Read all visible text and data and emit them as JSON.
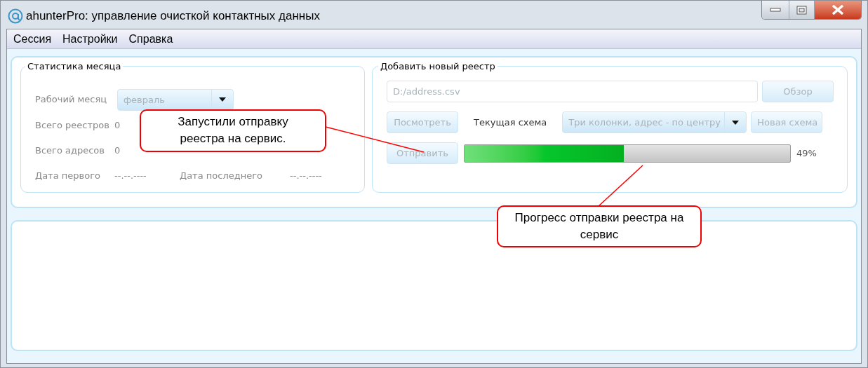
{
  "window": {
    "title": "ahunterPro: управление очисткой контактных данных"
  },
  "menu": [
    {
      "label": "Сессия"
    },
    {
      "label": "Настройки"
    },
    {
      "label": "Справка"
    }
  ],
  "month_stats": {
    "title": "Статистика месяца",
    "work_month": {
      "label": "Рабочий месяц",
      "value": "февраль",
      "disabled": true
    },
    "rows": [
      [
        {
          "label": "Всего реестров",
          "value": "0"
        }
      ],
      [
        {
          "label": "Всего адресов",
          "value": "0"
        }
      ],
      [
        {
          "label": "Дата первого",
          "value": "--.--.----"
        },
        {
          "label": "Дата последнего",
          "value": "--.--.----"
        }
      ]
    ]
  },
  "new_registry": {
    "title": "Добавить новый реестр",
    "file_field": {
      "value": "D:/address.csv",
      "disabled": true
    },
    "browse_button": {
      "label": "Обзор",
      "disabled": true
    },
    "view_button": {
      "label": "Посмотреть",
      "disabled": true
    },
    "scheme_label": "Текущая схема",
    "scheme": {
      "value": "Три колонки, адрес - по центру",
      "disabled": true
    },
    "new_scheme_button": {
      "label": "Новая схема",
      "disabled": true
    },
    "send_button": {
      "label": "Отправить",
      "disabled": true
    },
    "progress": {
      "level": 0.49,
      "reading": "49%"
    }
  },
  "callouts": [
    {
      "text": "Запустили отправку реестра на сервис."
    },
    {
      "text": "Прогресс отправки реестра на сервис"
    }
  ]
}
